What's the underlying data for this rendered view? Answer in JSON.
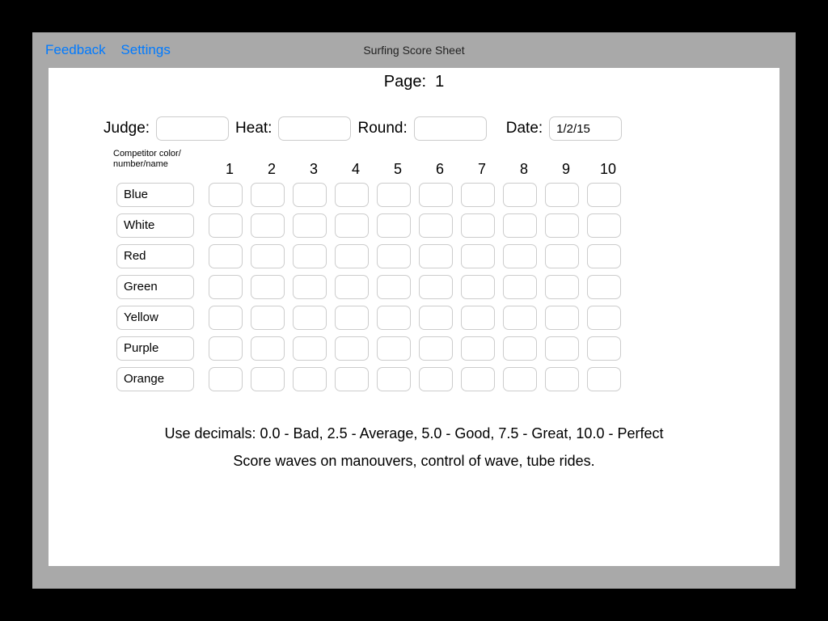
{
  "nav": {
    "feedback": "Feedback",
    "settings": "Settings",
    "title": "Surfing Score Sheet"
  },
  "page": {
    "label": "Page:",
    "value": "1"
  },
  "meta": {
    "judge_label": "Judge:",
    "judge_value": "",
    "heat_label": "Heat:",
    "heat_value": "",
    "round_label": "Round:",
    "round_value": "",
    "date_label": "Date:",
    "date_value": "1/2/15"
  },
  "legend": "Competitor color/\nnumber/name",
  "columns": [
    "1",
    "2",
    "3",
    "4",
    "5",
    "6",
    "7",
    "8",
    "9",
    "10"
  ],
  "competitors": [
    {
      "label": "Blue",
      "scores": [
        "",
        "",
        "",
        "",
        "",
        "",
        "",
        "",
        "",
        ""
      ]
    },
    {
      "label": "White",
      "scores": [
        "",
        "",
        "",
        "",
        "",
        "",
        "",
        "",
        "",
        ""
      ]
    },
    {
      "label": "Red",
      "scores": [
        "",
        "",
        "",
        "",
        "",
        "",
        "",
        "",
        "",
        ""
      ]
    },
    {
      "label": "Green",
      "scores": [
        "",
        "",
        "",
        "",
        "",
        "",
        "",
        "",
        "",
        ""
      ]
    },
    {
      "label": "Yellow",
      "scores": [
        "",
        "",
        "",
        "",
        "",
        "",
        "",
        "",
        "",
        ""
      ]
    },
    {
      "label": "Purple",
      "scores": [
        "",
        "",
        "",
        "",
        "",
        "",
        "",
        "",
        "",
        ""
      ]
    },
    {
      "label": "Orange",
      "scores": [
        "",
        "",
        "",
        "",
        "",
        "",
        "",
        "",
        "",
        ""
      ]
    }
  ],
  "help": {
    "line1": "Use decimals: 0.0 - Bad, 2.5 - Average, 5.0 - Good, 7.5 - Great, 10.0 - Perfect",
    "line2": "Score waves on manouvers, control of wave, tube rides."
  }
}
